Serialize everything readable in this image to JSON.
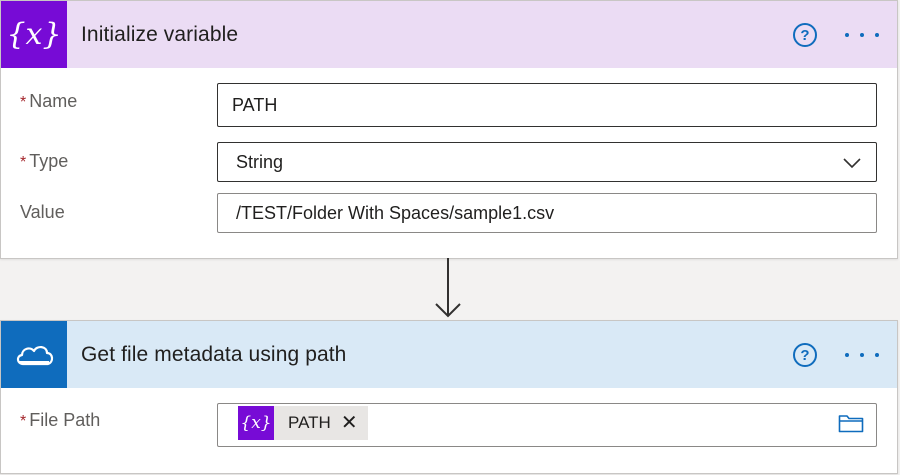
{
  "colors": {
    "variable_accent": "#770bd6",
    "onedrive_accent": "#0f6cbd",
    "required_star": "#a4262c"
  },
  "card1": {
    "icon": "variable-curly-x-icon",
    "icon_text": "{x}",
    "title": "Initialize variable",
    "help_label": "?",
    "fields": {
      "name": {
        "label": "Name",
        "required": "*",
        "value": "PATH"
      },
      "type": {
        "label": "Type",
        "required": "*",
        "value": "String"
      },
      "value": {
        "label": "Value",
        "value": "/TEST/Folder With Spaces/sample1.csv"
      }
    }
  },
  "card2": {
    "icon": "onedrive-cloud-icon",
    "title": "Get file metadata using path",
    "help_label": "?",
    "fields": {
      "file_path": {
        "label": "File Path",
        "required": "*",
        "token": {
          "icon_text": "{x}",
          "label": "PATH",
          "remove": "✕"
        }
      }
    }
  }
}
